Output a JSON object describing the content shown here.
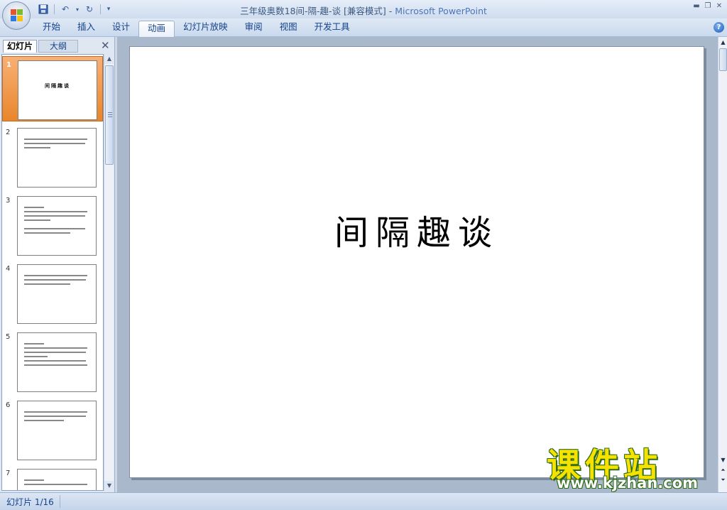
{
  "window": {
    "title": "三年级奥数18间-隔-趣-谈 [兼容模式] - ",
    "app_name": "Microsoft PowerPoint"
  },
  "quick_access": {
    "save_icon": "save-icon",
    "undo_icon": "undo-icon",
    "redo_icon": "redo-icon",
    "customize_icon": "customize-icon"
  },
  "ribbon": {
    "tabs": [
      "开始",
      "插入",
      "设计",
      "动画",
      "幻灯片放映",
      "审阅",
      "视图",
      "开发工具"
    ],
    "active_tab": "动画",
    "help_label": "?"
  },
  "panel": {
    "tab_slides": "幻灯片",
    "tab_outline": "大纲",
    "close_label": "✕"
  },
  "thumbnails": [
    {
      "num": "1",
      "title": "间隔趣谈"
    },
    {
      "num": "2"
    },
    {
      "num": "3"
    },
    {
      "num": "4"
    },
    {
      "num": "5"
    },
    {
      "num": "6"
    },
    {
      "num": "7"
    }
  ],
  "slide": {
    "title": "间隔趣谈"
  },
  "watermark": {
    "text": "课件站",
    "url": "www.kjzhan.com"
  },
  "status": {
    "slide_info": "幻灯片 1/16"
  },
  "colors": {
    "selected_thumb": "#e8862c",
    "ribbon_text": "#15428b",
    "watermark_yellow": "#f5e200",
    "watermark_green": "#2d6a16"
  }
}
